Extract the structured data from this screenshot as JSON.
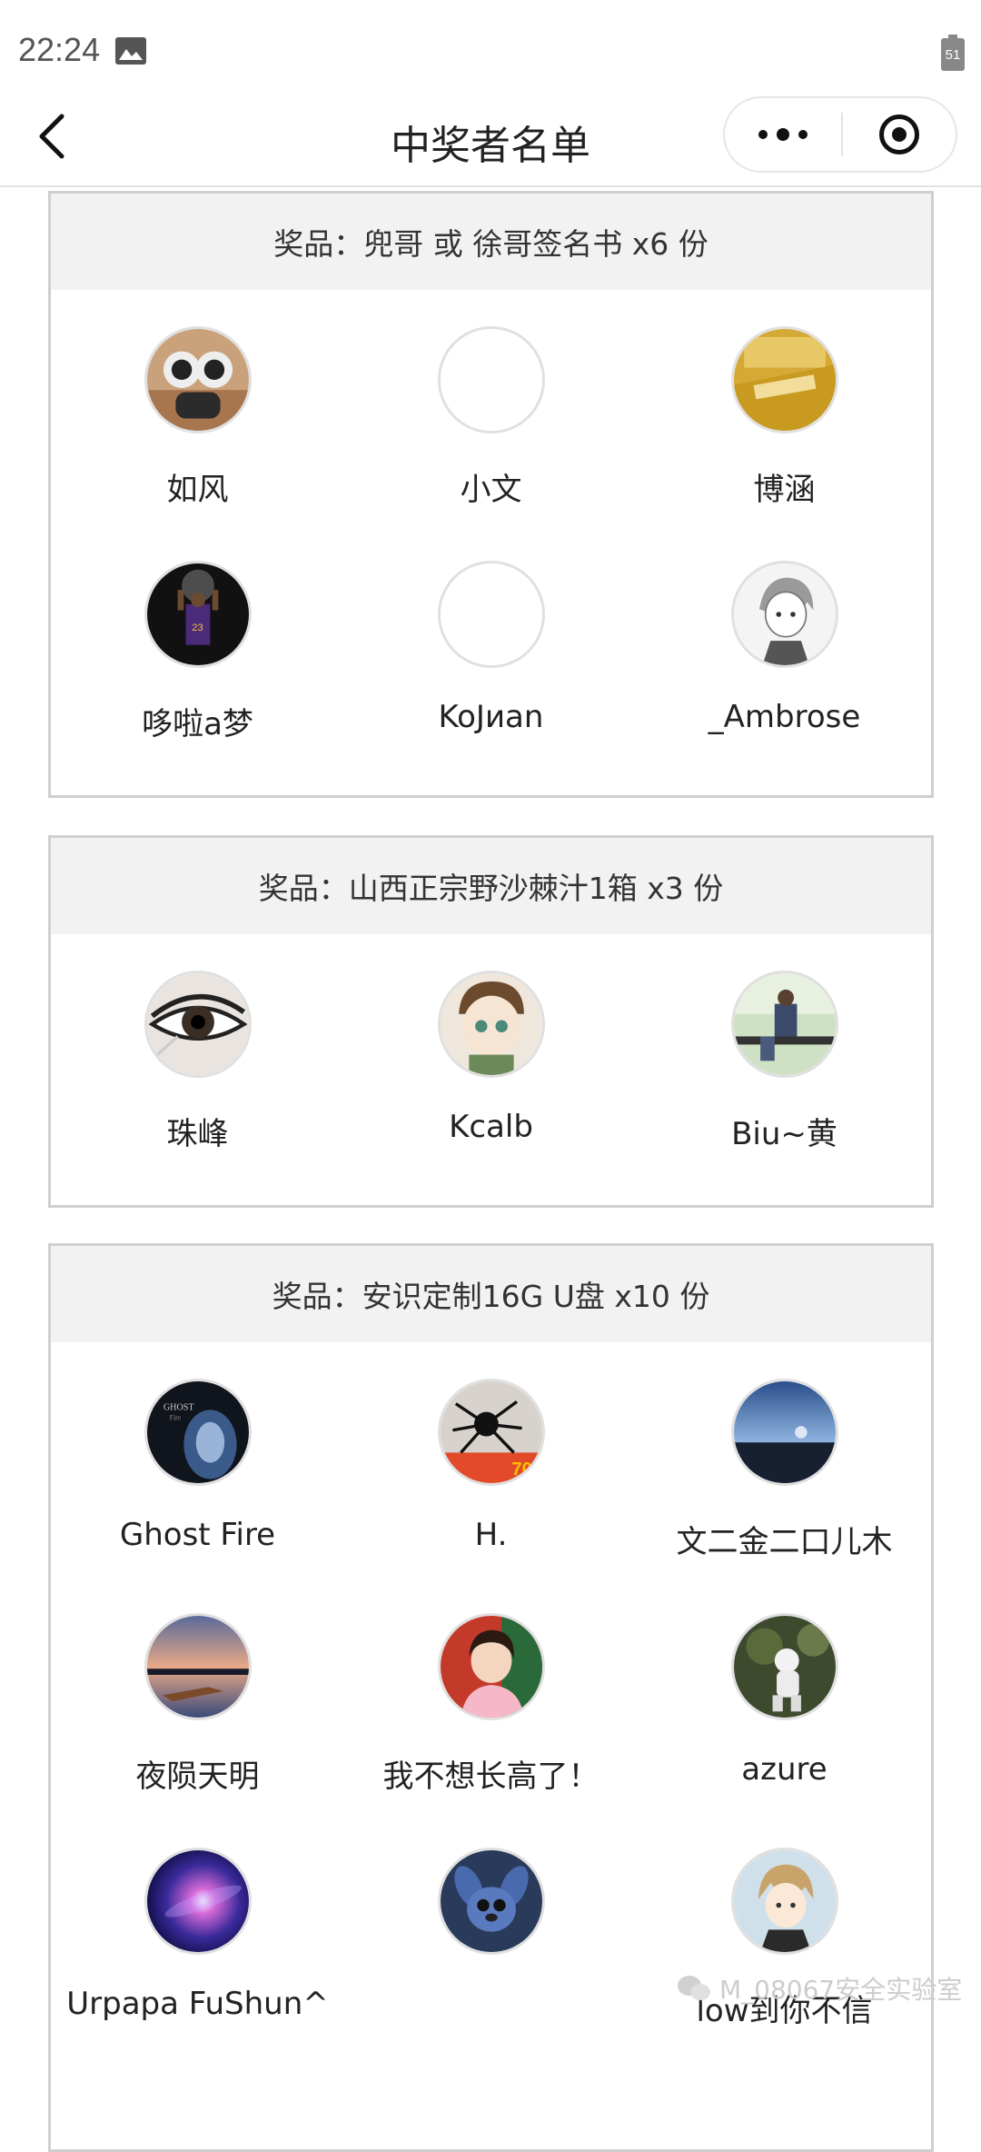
{
  "status": {
    "time": "22:24",
    "battery": "51"
  },
  "nav": {
    "title": "中奖者名单"
  },
  "sections": [
    {
      "title": "奖品：兜哥 或 徐哥签名书 x6 份",
      "winners": [
        "如风",
        "小文",
        "博涵",
        "哆啦a梦",
        "KoJиan",
        "_Ambrose"
      ]
    },
    {
      "title": "奖品：山西正宗野沙棘汁1箱 x3 份",
      "winners": [
        "珠峰",
        "Kcalb",
        "Biu~黄"
      ]
    },
    {
      "title": "奖品：安识定制16G U盘 x10 份",
      "winners": [
        "Ghost Fire",
        "H.",
        "文二金二口儿木",
        "夜陨天明",
        "我不想长高了！",
        "azure",
        "Urpapa FuShun^",
        "",
        "low到你不信"
      ]
    }
  ],
  "watermark": {
    "text": "M_08067安全实验室"
  }
}
